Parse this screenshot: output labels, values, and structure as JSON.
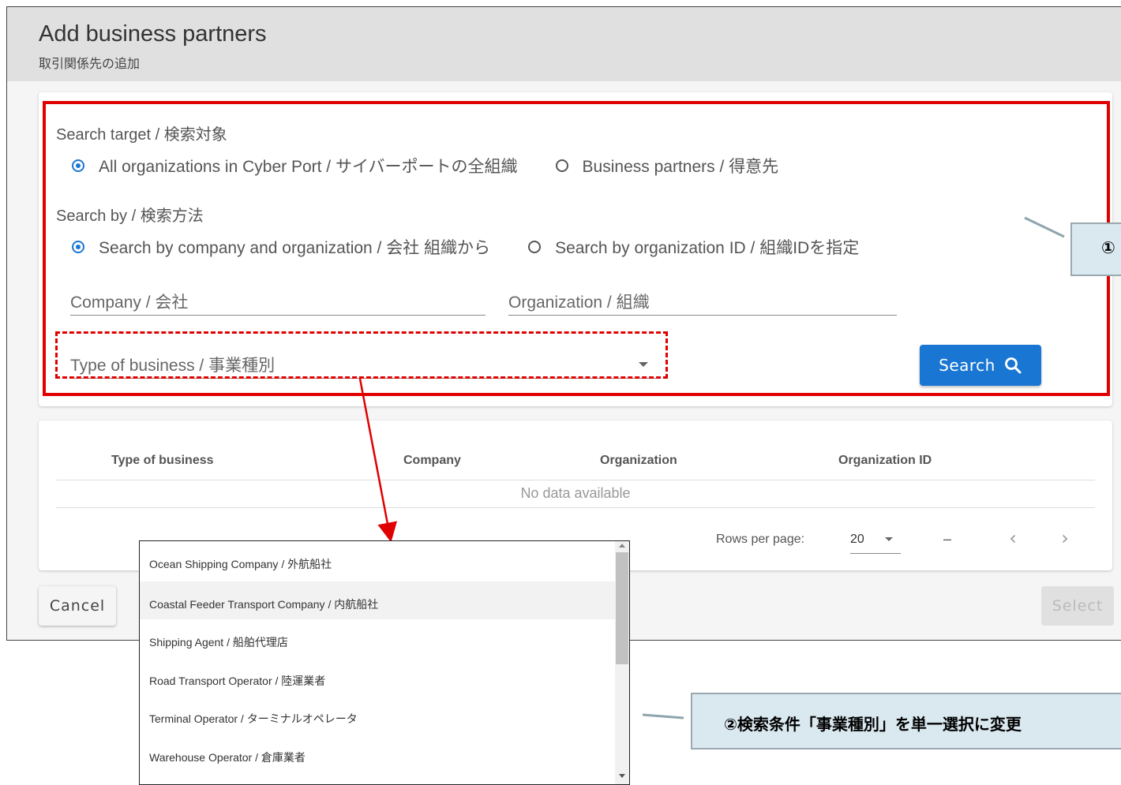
{
  "dialog": {
    "title": "Add business partners",
    "subtitle": "取引関係先の追加"
  },
  "search": {
    "target_label": "Search target / 検索対象",
    "target_options": [
      "All organizations in Cyber Port / サイバーポートの全組織",
      "Business partners / 得意先"
    ],
    "target_selected": "All organizations in Cyber Port / サイバーポートの全組織",
    "by_label": "Search by / 検索方法",
    "by_options": [
      "Search by company and organization / 会社 組織から",
      "Search by organization ID / 組織IDを指定"
    ],
    "by_selected": "Search by company and organization / 会社 組織から",
    "company_placeholder": "Company / 会社",
    "organization_placeholder": "Organization / 組織",
    "business_type_placeholder": "Type of business / 事業種別",
    "search_button": "Search"
  },
  "table": {
    "columns": [
      "Type of business",
      "Company",
      "Organization",
      "Organization ID"
    ],
    "empty_text": "No data available",
    "rows_per_page_label": "Rows per page:",
    "rows_per_page_value": "20",
    "range_text": "–",
    "prev": "‹",
    "next": "›"
  },
  "footer": {
    "cancel": "Cancel",
    "select": "Select"
  },
  "dropdown": {
    "items": [
      "Ocean Shipping Company / 外航船社",
      "Coastal Feeder Transport Company / 内航船社",
      "Shipping Agent / 船舶代理店",
      "Road Transport Operator / 陸運業者",
      "Terminal Operator / ターミナルオペレータ",
      "Warehouse Operator / 倉庫業者"
    ],
    "highlighted": "Coastal Feeder Transport Company / 内航船社"
  },
  "annotations": {
    "callout1": "①",
    "callout2": "②検索条件「事業種別」を単一選択に変更",
    "highlight_color": "#e00000",
    "callout_bg": "#dae8ef"
  },
  "colors": {
    "primary": "#1976d2"
  }
}
